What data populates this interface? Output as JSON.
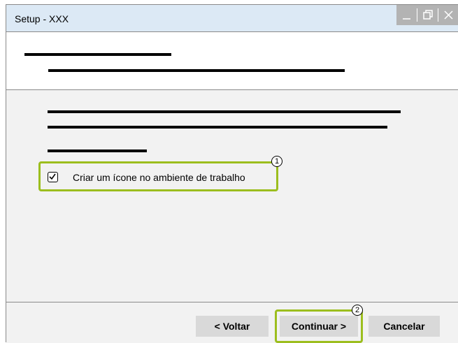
{
  "window": {
    "title": "Setup - XXX"
  },
  "titlebar_buttons": [
    {
      "name": "minimize",
      "icon": "minimize-icon"
    },
    {
      "name": "maximize",
      "icon": "maximize-icon"
    },
    {
      "name": "close",
      "icon": "close-icon"
    }
  ],
  "options": {
    "desktop_icon": {
      "label": "Criar um ícone no ambiente de trabalho",
      "checked": true,
      "callout": "1"
    }
  },
  "footer": {
    "back_label": "< Voltar",
    "next_label": "Continuar >",
    "cancel_label": "Cancelar",
    "next_callout": "2"
  },
  "colors": {
    "titlebar_bg": "#dce9f5",
    "window_controls_bg": "#b3b3b3",
    "content_bg": "#f2f2f2",
    "button_bg": "#d9d9d9",
    "highlight": "#9cbe1e"
  }
}
